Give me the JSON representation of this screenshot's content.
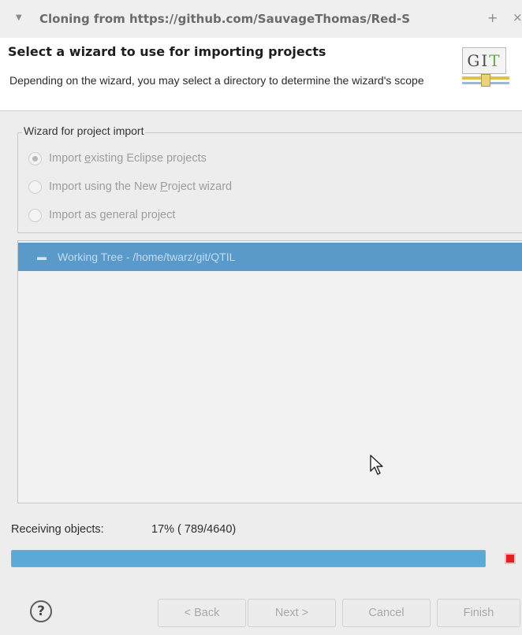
{
  "window": {
    "title": "Cloning from https://github.com/SauvageThomas/Red-S",
    "new_tab_glyph": "+",
    "close_glyph": "×"
  },
  "header": {
    "title": "Select a wizard to use for importing projects",
    "description": "Depending on the wizard, you may select a directory to determine the wizard's scope",
    "logo_text_1": "G",
    "logo_text_2": "I",
    "logo_text_3": "T"
  },
  "wizard_group": {
    "label": "Wizard for project import",
    "options": [
      {
        "pre": "Import ",
        "mnemonic": "e",
        "post": "xisting Eclipse projects",
        "selected": true
      },
      {
        "pre": "Import using the New ",
        "mnemonic": "P",
        "post": "roject wizard",
        "selected": false
      },
      {
        "pre": "Import as ",
        "mnemonic": "g",
        "post": "eneral project",
        "selected": false
      }
    ]
  },
  "tree": {
    "items": [
      {
        "label": "Working Tree - /home/twarz/git/QTIL",
        "icon": "folder-icon",
        "selected": true
      }
    ]
  },
  "progress": {
    "label": "Receiving objects:",
    "value_text": "17% ( 789/4640)",
    "fraction": 0.17,
    "bar_color": "#5aa9d8"
  },
  "buttons": {
    "help": "?",
    "back": "< Back",
    "next": "Next >",
    "cancel": "Cancel",
    "finish": "Finish"
  },
  "colors": {
    "selection": "#5a9acb",
    "stop": "#e22020"
  }
}
